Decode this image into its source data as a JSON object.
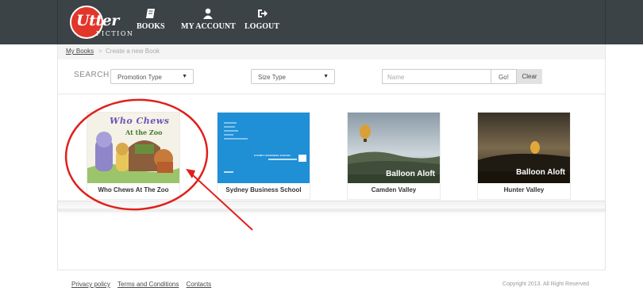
{
  "header": {
    "logo_text": "Utter",
    "logo_sub": "FICTION",
    "nav": [
      {
        "label": "BOOKS",
        "icon": "book-icon"
      },
      {
        "label": "MY ACCOUNT",
        "icon": "user-icon"
      },
      {
        "label": "LOGOUT",
        "icon": "logout-icon"
      }
    ]
  },
  "breadcrumb": {
    "link": "My Books",
    "separator": ">",
    "current": "Create a new Book"
  },
  "search": {
    "label": "SEARCH",
    "promotion_type": "Promotion Type",
    "size_type": "Size Type",
    "name_placeholder": "Name",
    "go_label": "Go!",
    "clear_label": "Clear"
  },
  "books": [
    {
      "title": "Who Chews At The Zoo"
    },
    {
      "title": "Sydney Business School"
    },
    {
      "title": "Camden Valley"
    },
    {
      "title": "Hunter Valley"
    }
  ],
  "covers": {
    "zoo_line1": "Who Chews",
    "zoo_line2": "At the Zoo",
    "sbs_name": "SYDNEY BUSINESS SCHOOL",
    "balloon": "Balloon Aloft"
  },
  "footer": {
    "links": [
      "Privacy policy",
      "Terms and Conditions",
      "Contacts"
    ],
    "copyright": "Copyright 2013. All Right Reserved"
  },
  "colors": {
    "header_bg": "#3c4347",
    "brand_red": "#e2362a",
    "annotation_red": "#e0201c",
    "sbs_blue": "#1f8fd6"
  }
}
